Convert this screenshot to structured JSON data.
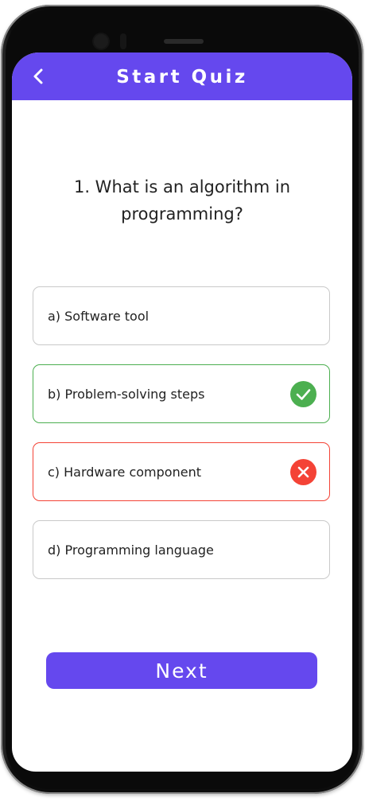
{
  "appbar": {
    "title": "Start Quiz",
    "back_icon": "chevron-left-icon",
    "color": "#6548ee"
  },
  "question": {
    "text": "1. What is an algorithm in programming?"
  },
  "options": [
    {
      "label": "a) Software tool",
      "state": "default"
    },
    {
      "label": "b) Problem-solving steps",
      "state": "correct",
      "icon": "check-circle-icon",
      "color": "#4caf50"
    },
    {
      "label": "c) Hardware component",
      "state": "wrong",
      "icon": "x-circle-icon",
      "color": "#f44336"
    },
    {
      "label": "d) Programming language",
      "state": "default"
    }
  ],
  "next_button": {
    "label": "Next",
    "color": "#6548ee"
  }
}
